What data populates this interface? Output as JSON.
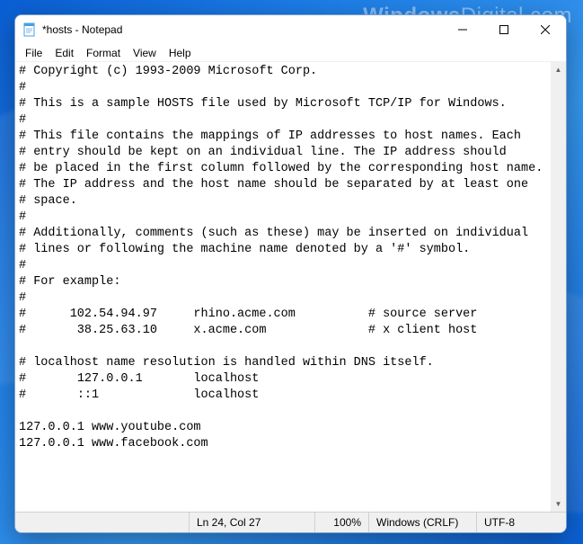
{
  "watermark": {
    "a": "Windows",
    "b": "Digital",
    "c": ".com"
  },
  "window": {
    "title": "*hosts - Notepad"
  },
  "menu": {
    "file": "File",
    "edit": "Edit",
    "format": "Format",
    "view": "View",
    "help": "Help"
  },
  "content": "# Copyright (c) 1993-2009 Microsoft Corp.\n#\n# This is a sample HOSTS file used by Microsoft TCP/IP for Windows.\n#\n# This file contains the mappings of IP addresses to host names. Each\n# entry should be kept on an individual line. The IP address should\n# be placed in the first column followed by the corresponding host name.\n# The IP address and the host name should be separated by at least one\n# space.\n#\n# Additionally, comments (such as these) may be inserted on individual\n# lines or following the machine name denoted by a '#' symbol.\n#\n# For example:\n#\n#      102.54.94.97     rhino.acme.com          # source server\n#       38.25.63.10     x.acme.com              # x client host\n\n# localhost name resolution is handled within DNS itself.\n#\t127.0.0.1       localhost\n#\t::1             localhost\n\n127.0.0.1 www.youtube.com\n127.0.0.1 www.facebook.com",
  "status": {
    "position": "Ln 24, Col 27",
    "zoom": "100%",
    "line_ending": "Windows (CRLF)",
    "encoding": "UTF-8"
  }
}
